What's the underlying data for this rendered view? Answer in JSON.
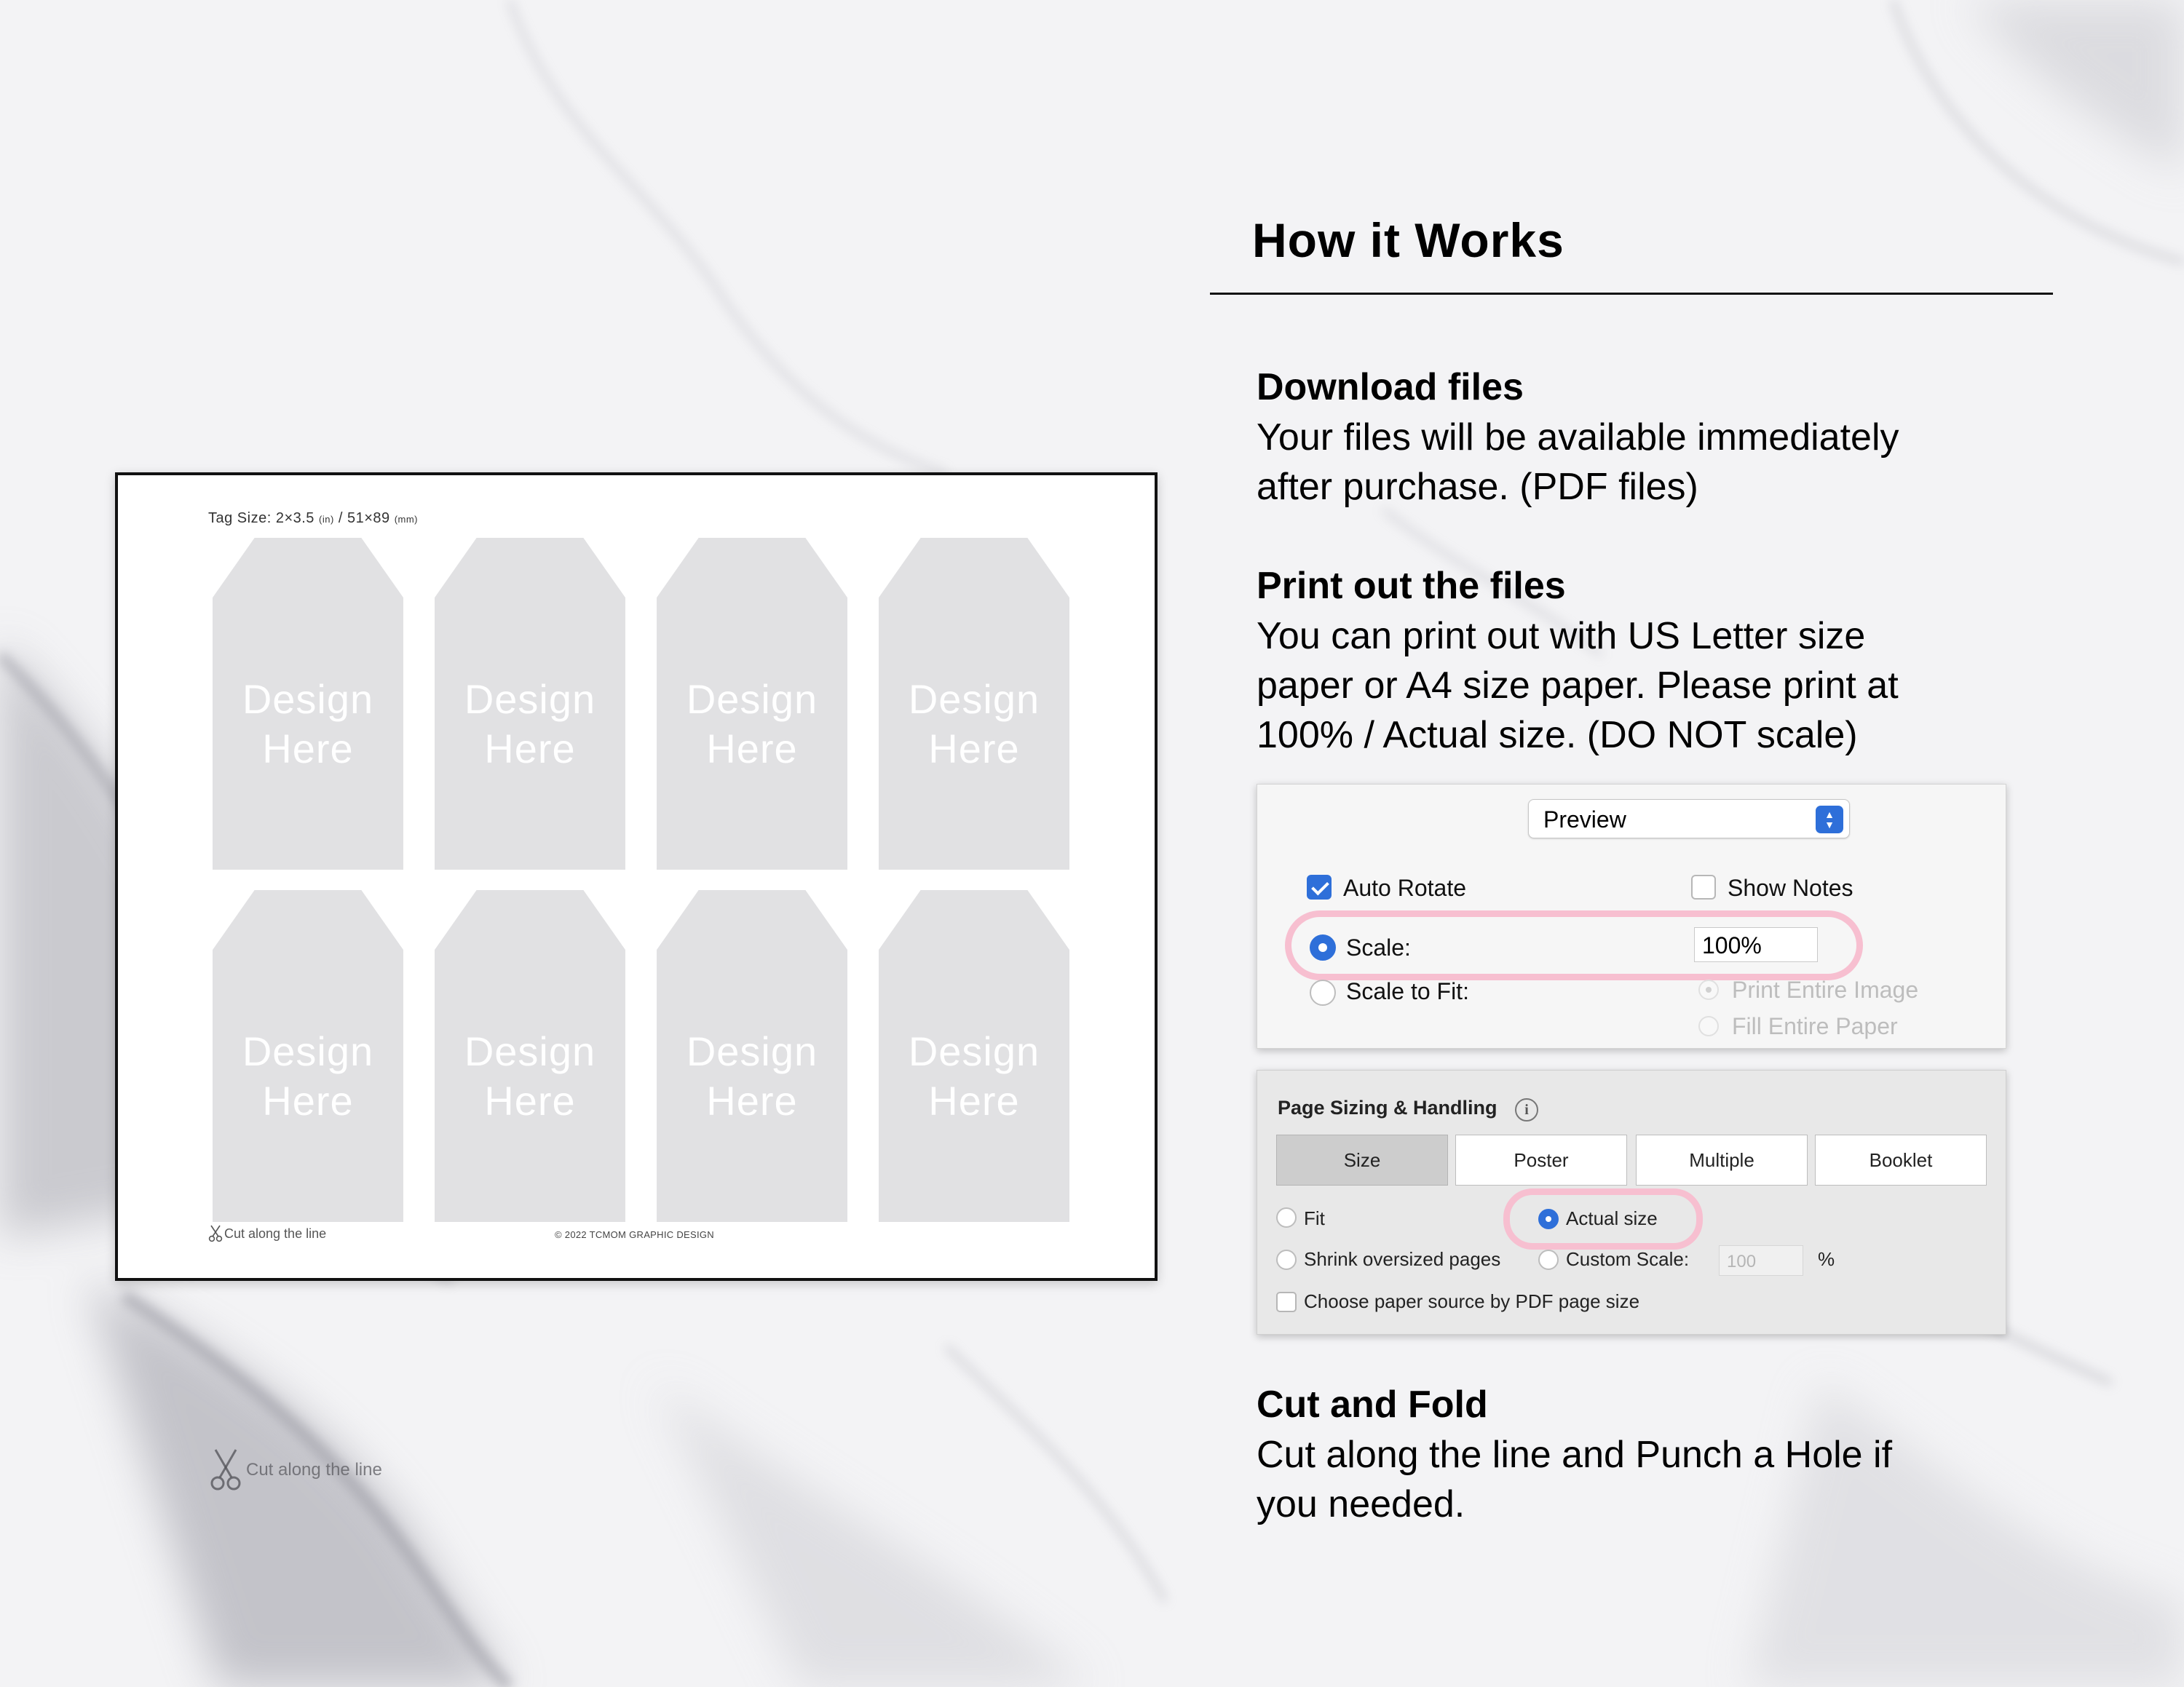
{
  "template_sheet": {
    "tag_size_main": "Tag Size: 2×3.5",
    "tag_size_unit_in": "(in)",
    "tag_size_sep": " / 51×89",
    "tag_size_unit_mm": "(mm)",
    "tags": [
      {
        "text": "Design\nHere"
      },
      {
        "text": "Design\nHere"
      },
      {
        "text": "Design\nHere"
      },
      {
        "text": "Design\nHere"
      },
      {
        "text": "Design\nHere"
      },
      {
        "text": "Design\nHere"
      },
      {
        "text": "Design\nHere"
      },
      {
        "text": "Design\nHere"
      }
    ],
    "cut_line_label": "Cut along the line",
    "copyright": "© 2022 TCMOM GRAPHIC DESIGN"
  },
  "background_cut_label": "Cut along the line",
  "how_it_works": {
    "title": "How it Works",
    "sections": [
      {
        "heading": "Download files",
        "body": "Your files will be available immediately\nafter purchase. (PDF files)"
      },
      {
        "heading": "Print out the files",
        "body": "You can print out with US Letter size\npaper or A4 size paper. Please print at\n100% / Actual size.  (DO NOT scale)"
      },
      {
        "heading": "Cut and Fold",
        "body": "Cut along the line and Punch a Hole if\nyou needed."
      }
    ]
  },
  "preview_dialog": {
    "app_select": "Preview",
    "auto_rotate": {
      "label": "Auto Rotate",
      "checked": true
    },
    "show_notes": {
      "label": "Show Notes",
      "checked": false
    },
    "scale": {
      "label": "Scale:",
      "value": "100%",
      "selected": true
    },
    "scale_to_fit": {
      "label": "Scale to Fit:",
      "selected": false
    },
    "print_entire_image": {
      "label": "Print Entire Image",
      "enabled": false
    },
    "fill_entire_paper": {
      "label": "Fill Entire Paper",
      "enabled": false
    }
  },
  "acrobat_dialog": {
    "title": "Page Sizing & Handling",
    "info_icon": "i",
    "buttons": [
      "Size",
      "Poster",
      "Multiple",
      "Booklet"
    ],
    "selected_button": "Size",
    "fit": "Fit",
    "actual_size": "Actual size",
    "shrink": "Shrink oversized pages",
    "custom_scale": "Custom Scale:",
    "custom_scale_value": "100",
    "percent": "%",
    "paper_source": "Choose paper source by PDF page size"
  },
  "colors": {
    "accent": "#2e6fd9",
    "highlight": "#f7bfd0",
    "tag_fill": "#e1e1e3"
  }
}
